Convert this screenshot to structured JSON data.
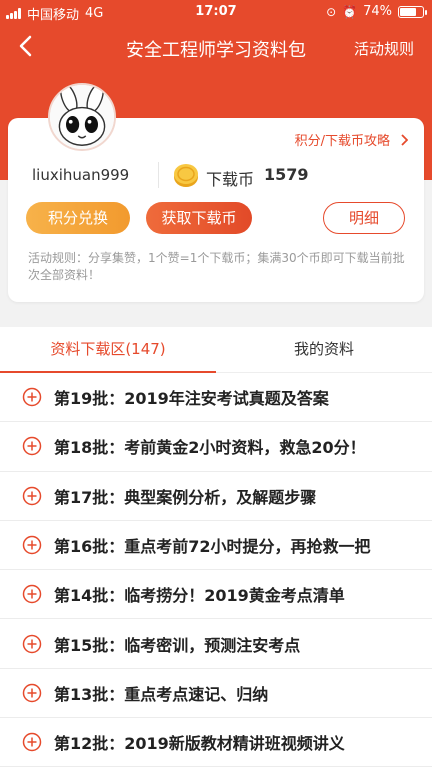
{
  "status_bar": {
    "carrier": "中国移动",
    "network": "4G",
    "time": "17:07",
    "battery": "74%",
    "battery_level": 0.74,
    "icons": [
      "signal-icon",
      "lock-rotation-icon",
      "alarm-icon",
      "battery-icon"
    ]
  },
  "nav": {
    "title": "安全工程师学习资料包",
    "right_label": "活动规则",
    "back_icon": "chevron-left-icon"
  },
  "card": {
    "strategy_link": "积分/下载币攻略",
    "username": "liuxihuan999",
    "coin_label": "下载币",
    "coin_count": "1579",
    "buttons": {
      "exchange": "积分兑换",
      "get_coins": "获取下载币",
      "detail": "明细"
    },
    "rules": "活动规则：分享集赞，1个赞=1个下载币；集满30个币即可下载当前批次全部资料！"
  },
  "tabs": [
    {
      "label": "资料下载区(147)",
      "active": true
    },
    {
      "label": "我的资料",
      "active": false
    }
  ],
  "list_items": [
    {
      "label": "第19批：2019年注安考试真题及答案"
    },
    {
      "label": "第18批：考前黄金2小时资料，救急20分！"
    },
    {
      "label": "第17批：典型案例分析，及解题步骤"
    },
    {
      "label": "第16批：重点考前72小时提分，再抢救一把"
    },
    {
      "label": "第14批：临考捞分！2019黄金考点清单"
    },
    {
      "label": "第15批：临考密训，预测注安考点"
    },
    {
      "label": "第13批：重点考点速记、归纳"
    },
    {
      "label": "第12批：2019新版教材精讲班视频讲义"
    }
  ],
  "colors": {
    "brand_red": "#e64a2c",
    "orange": "#f29a2e",
    "background": "#f2f2f2"
  }
}
